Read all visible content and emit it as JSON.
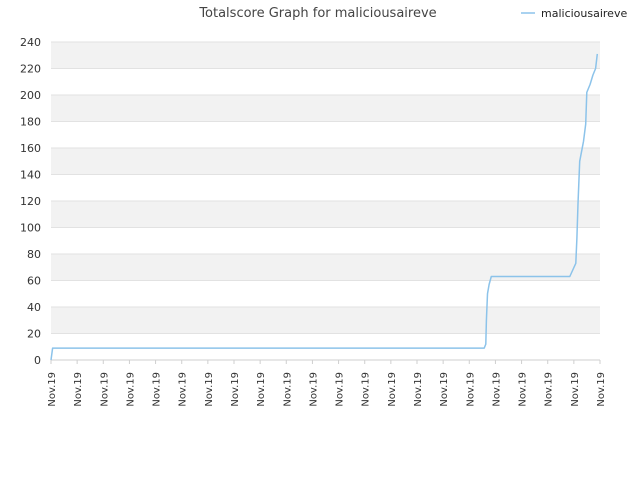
{
  "chart_data": {
    "type": "line",
    "title": "Totalscore Graph for maliciousaireve",
    "legend": {
      "placement": "top-right",
      "entries": [
        "maliciousaireve"
      ]
    },
    "ylim": [
      0,
      240
    ],
    "yticks": [
      0,
      20,
      40,
      60,
      80,
      100,
      120,
      140,
      160,
      180,
      200,
      220,
      240
    ],
    "xtick_labels": [
      "Nov.19",
      "Nov.19",
      "Nov.19",
      "Nov.19",
      "Nov.19",
      "Nov.19",
      "Nov.19",
      "Nov.19",
      "Nov.19",
      "Nov.19",
      "Nov.19",
      "Nov.19",
      "Nov.19",
      "Nov.19",
      "Nov.19",
      "Nov.19",
      "Nov.19",
      "Nov.19",
      "Nov.19",
      "Nov.19",
      "Nov.19",
      "Nov.19"
    ],
    "grid": "horizontal alternating bands",
    "series": [
      {
        "name": "maliciousaireve",
        "color": "#8cc3ea",
        "points": [
          [
            0,
            0
          ],
          [
            0.003,
            9
          ],
          [
            0.789,
            9
          ],
          [
            0.792,
            12
          ],
          [
            0.793,
            30
          ],
          [
            0.795,
            50
          ],
          [
            0.798,
            57
          ],
          [
            0.802,
            63
          ],
          [
            0.945,
            63
          ],
          [
            0.956,
            73
          ],
          [
            0.958,
            92
          ],
          [
            0.96,
            118
          ],
          [
            0.963,
            150
          ],
          [
            0.97,
            165
          ],
          [
            0.974,
            178
          ],
          [
            0.976,
            202
          ],
          [
            0.982,
            208
          ],
          [
            0.987,
            215
          ],
          [
            0.992,
            220
          ],
          [
            0.995,
            231
          ]
        ]
      }
    ]
  }
}
